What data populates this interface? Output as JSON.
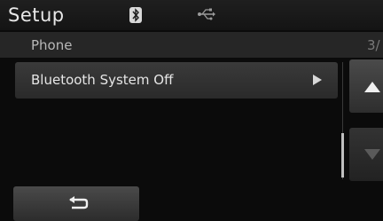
{
  "header": {
    "title": "Setup",
    "icons": [
      "bluetooth-icon",
      "usb-icon"
    ]
  },
  "subheader": {
    "title": "Phone",
    "page": "3/"
  },
  "list": {
    "items": [
      {
        "label": "Bluetooth System Off",
        "icon": "play-icon"
      }
    ]
  },
  "scroll": {
    "up_icon": "triangle-up-icon",
    "down_icon": "triangle-down-icon"
  },
  "footer": {
    "back_icon": "back-arrow-icon"
  },
  "colors": {
    "background": "#0b0b0b",
    "text": "#e6e6e6",
    "button": "#3a3a3a"
  }
}
